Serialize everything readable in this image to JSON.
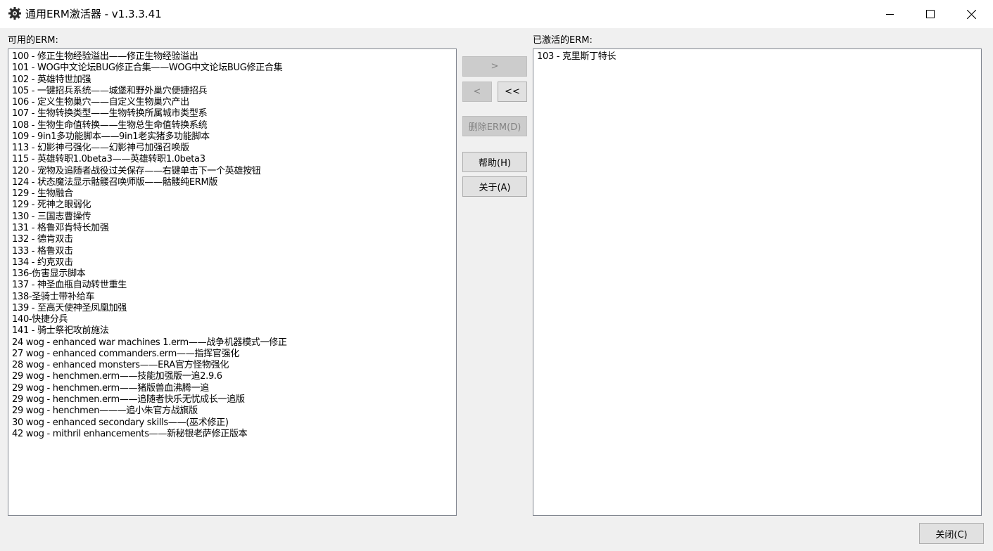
{
  "window": {
    "title": "通用ERM激活器 - v1.3.3.41",
    "icon": "gear-icon"
  },
  "labels": {
    "available": "可用的ERM:",
    "active": "已激活的ERM:"
  },
  "available_items": [
    "100 - 修正生物经验溢出——修正生物经验溢出",
    "101 - WOG中文论坛BUG修正合集——WOG中文论坛BUG修正合集",
    "102 - 英雄特世加强",
    "105 - 一键招兵系统——城堡和野外巢穴便捷招兵",
    "106 - 定义生物巢穴——自定义生物巢穴产出",
    "107 - 生物转换类型——生物转换所属城市类型系",
    "108 - 生物生命值转换——生物总生命值转换系统",
    "109 - 9in1多功能脚本——9in1老实猪多功能脚本",
    "113 - 幻影神弓强化——幻影神弓加强召唤版",
    "115 - 英雄转职1.0beta3——英雄转职1.0beta3",
    "120 - 宠物及追随者战役过关保存——右键单击下一个英雄按钮",
    "124 - 状态魔法显示骷髅召唤师版——骷髅纯ERM版",
    "129 - 生物融合",
    "129 - 死神之眼弱化",
    "130 - 三国志曹操传",
    "131 - 格鲁邓肯特长加强",
    "132 - 德肯双击",
    "133 - 格鲁双击",
    "134 - 约克双击",
    "136-伤害显示脚本",
    "137 - 神圣血瓶自动转世重生",
    "138-圣骑士带补给车",
    "139 - 至高天使神圣凤凰加强",
    "140-快捷分兵",
    "141 - 骑士祭祀攻前施法",
    "24 wog - enhanced war machines 1.erm——战争机器模式一修正",
    "27 wog - enhanced commanders.erm——指挥官强化",
    "28 wog - enhanced monsters——ERA官方怪物强化",
    "29 wog - henchmen.erm——技能加强版一追2.9.6",
    "29 wog - henchmen.erm——猪版兽血沸腾一追",
    "29 wog - henchmen.erm——追随者快乐无忧成长一追版",
    "29 wog - henchmen———追小朱官方战旗版",
    "30 wog - enhanced secondary skills——(巫术修正)",
    "42 wog - mithril enhancements——新秘银老萨修正版本"
  ],
  "active_items": [
    "103 - 克里斯丁特长"
  ],
  "buttons": {
    "add": ">",
    "remove": "<",
    "remove_all": "<<",
    "delete": "删除ERM(D)",
    "help": "帮助(H)",
    "about": "关于(A)",
    "close": "关闭(C)"
  }
}
